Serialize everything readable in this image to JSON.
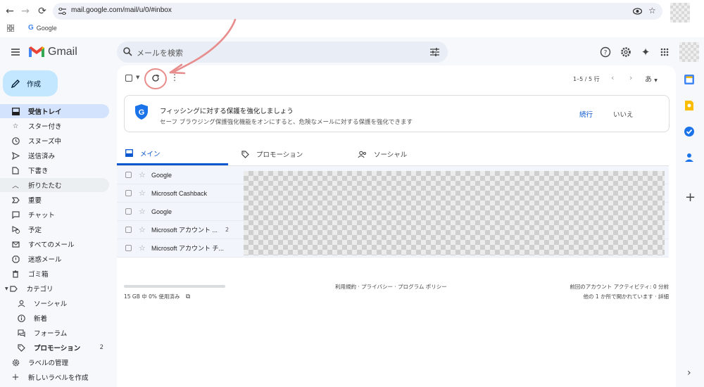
{
  "browser": {
    "url": "mail.google.com/mail/u/0/#inbox",
    "bookmark_label": "Google"
  },
  "app": {
    "name": "Gmail",
    "search_placeholder": "メールを検索",
    "compose_label": "作成"
  },
  "sidebar": {
    "items": [
      {
        "label": "受信トレイ",
        "icon": "inbox-icon",
        "active": true
      },
      {
        "label": "スター付き",
        "icon": "star-icon"
      },
      {
        "label": "スヌーズ中",
        "icon": "clock-icon"
      },
      {
        "label": "送信済み",
        "icon": "send-icon"
      },
      {
        "label": "下書き",
        "icon": "draft-icon"
      },
      {
        "label": "折りたたむ",
        "icon": "chevron-up-icon"
      },
      {
        "label": "重要",
        "icon": "important-icon"
      },
      {
        "label": "チャット",
        "icon": "chat-icon"
      },
      {
        "label": "予定",
        "icon": "scheduled-icon"
      },
      {
        "label": "すべてのメール",
        "icon": "all-mail-icon"
      },
      {
        "label": "迷惑メール",
        "icon": "spam-icon"
      },
      {
        "label": "ゴミ箱",
        "icon": "trash-icon"
      },
      {
        "label": "カテゴリ",
        "icon": "label-icon"
      },
      {
        "label": "ソーシャル",
        "icon": "people-icon"
      },
      {
        "label": "新着",
        "icon": "info-icon"
      },
      {
        "label": "フォーラム",
        "icon": "forum-icon"
      },
      {
        "label": "プロモーション",
        "icon": "tag-icon",
        "count": "2"
      },
      {
        "label": "ラベルの管理",
        "icon": "gear-icon"
      },
      {
        "label": "新しいラベルを作成",
        "icon": "plus-icon"
      }
    ]
  },
  "toolbar": {
    "pager": "1–5 / 5 行",
    "lang": "あ"
  },
  "banner": {
    "title": "フィッシングに対する保護を強化しましょう",
    "body": "セーフ ブラウジング保護強化機能をオンにすると、危険なメールに対する保護を強化できます",
    "continue": "続行",
    "dismiss": "いいえ"
  },
  "tabs": [
    {
      "label": "メイン",
      "icon": "inbox-icon"
    },
    {
      "label": "プロモーション",
      "icon": "tag-icon"
    },
    {
      "label": "ソーシャル",
      "icon": "people-icon"
    }
  ],
  "emails": [
    {
      "sender": "Google",
      "count": ""
    },
    {
      "sender": "Microsoft Cashback",
      "count": ""
    },
    {
      "sender": "Google",
      "count": ""
    },
    {
      "sender": "Microsoft アカウント ...",
      "count": "2"
    },
    {
      "sender": "Microsoft アカウント チ...",
      "count": ""
    }
  ],
  "footer": {
    "storage": "15 GB 中 0% 使用済み",
    "links": "利用規約 · プライバシー · プログラム ポリシー",
    "activity": "前回のアカウント アクティビティ: 0 分前",
    "details": "他の 1 か所で開かれています · 詳細"
  },
  "colors": {
    "accent": "#0b57d0",
    "compose_bg": "#c2e7ff",
    "active_item_bg": "#d3e3fd",
    "annotation": "#e57373"
  }
}
